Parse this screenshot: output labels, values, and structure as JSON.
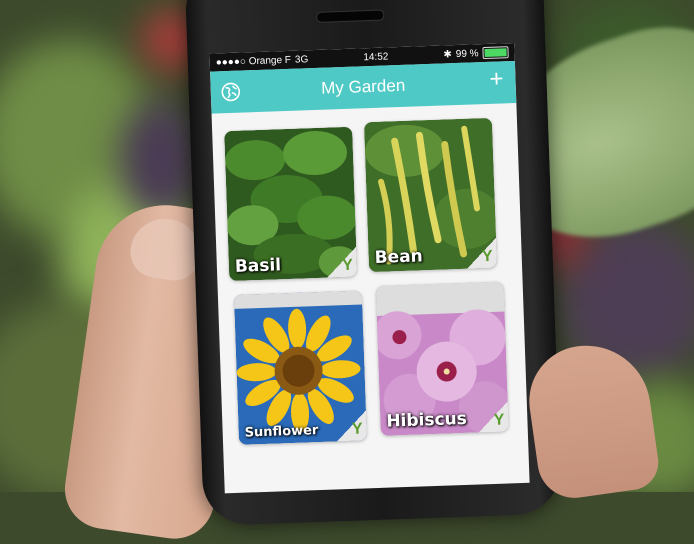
{
  "status_bar": {
    "carrier": "●●●●○ Orange F",
    "network": "3G",
    "time": "14:52",
    "battery_percent": "99 %",
    "battery_level": 0.99
  },
  "nav": {
    "title": "My Garden",
    "globe_icon": "globe-icon",
    "add_icon": "plus-icon",
    "accent_color": "#4fc9c6"
  },
  "plants": [
    {
      "name": "Basil",
      "badge": "Y"
    },
    {
      "name": "Bean",
      "badge": "Y"
    },
    {
      "name": "Sunflower",
      "badge": "Y"
    },
    {
      "name": "Hibiscus",
      "badge": "Y"
    }
  ]
}
